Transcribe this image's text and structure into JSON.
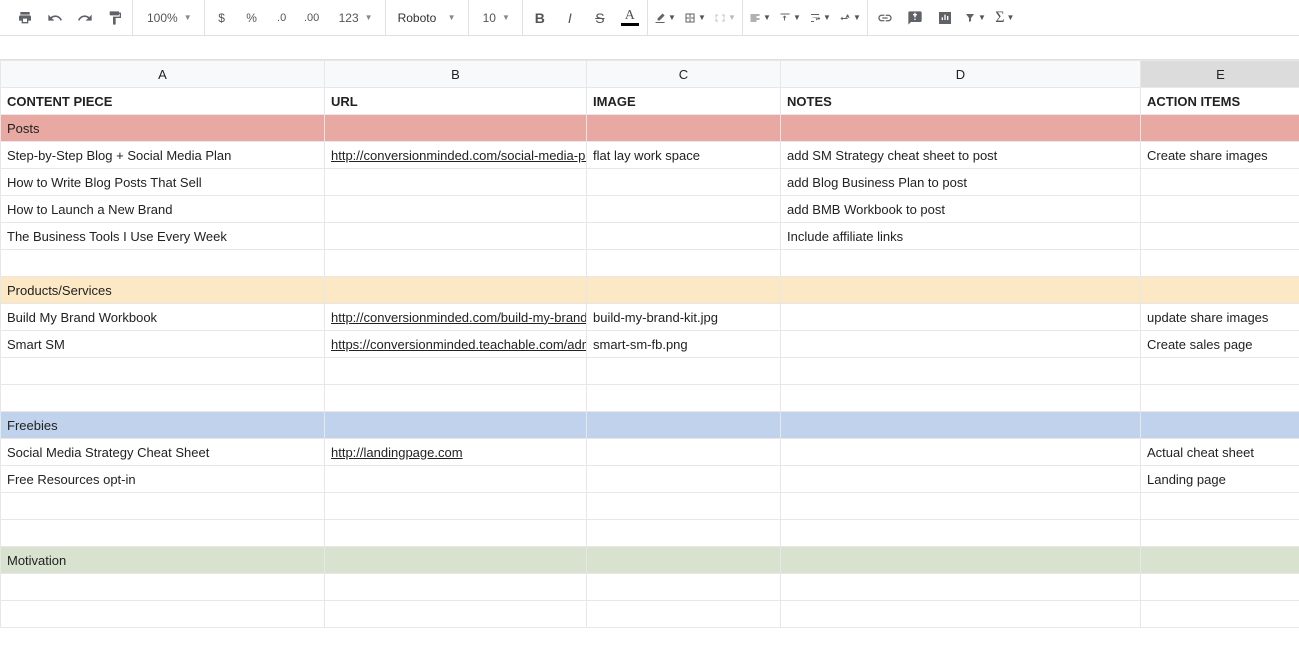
{
  "toolbar": {
    "zoom": "100%",
    "currency": "$",
    "percent": "%",
    "dec_decrease": ".0",
    "dec_increase": ".00",
    "more_formats": "123",
    "font": "Roboto",
    "font_size": "10",
    "bold": "B",
    "italic": "I",
    "strike": "S",
    "text_color": "A"
  },
  "columns": [
    "A",
    "B",
    "C",
    "D",
    "E"
  ],
  "headers": {
    "a": "CONTENT PIECE",
    "b": "URL",
    "c": "IMAGE",
    "d": "NOTES",
    "e": "ACTION ITEMS"
  },
  "sections": {
    "posts": "Posts",
    "products": "Products/Services",
    "freebies": "Freebies",
    "motivation": "Motivation"
  },
  "rows": {
    "r1": {
      "a": "Step-by-Step Blog + Social Media Plan",
      "b": "http://conversionminded.com/social-media-plan/",
      "c": "flat lay work space",
      "d": "add SM Strategy cheat sheet to post",
      "e": "Create share images"
    },
    "r2": {
      "a": "How to Write Blog Posts That Sell",
      "b": "",
      "c": "",
      "d": "add Blog Business Plan to post",
      "e": ""
    },
    "r3": {
      "a": "How to Launch a New Brand",
      "b": "",
      "c": "",
      "d": "add BMB Workbook to post",
      "e": ""
    },
    "r4": {
      "a": "The Business Tools I Use Every Week",
      "b": "",
      "c": "",
      "d": "Include affiliate links",
      "e": ""
    },
    "r5": {
      "a": "Build My Brand Workbook",
      "b": "http://conversionminded.com/build-my-brand-wor",
      "c": "build-my-brand-kit.jpg",
      "d": "",
      "e": "update share images"
    },
    "r6": {
      "a": "Smart SM",
      "b": "https://conversionminded.teachable.com/admin/",
      "c": "smart-sm-fb.png",
      "d": "",
      "e": "Create sales page"
    },
    "r7": {
      "a": "Social Media Strategy Cheat Sheet",
      "b": "http://landingpage.com",
      "c": "",
      "d": "",
      "e": "Actual cheat sheet"
    },
    "r8": {
      "a": "Free Resources opt-in",
      "b": "",
      "c": "",
      "d": "",
      "e": "Landing page"
    }
  }
}
